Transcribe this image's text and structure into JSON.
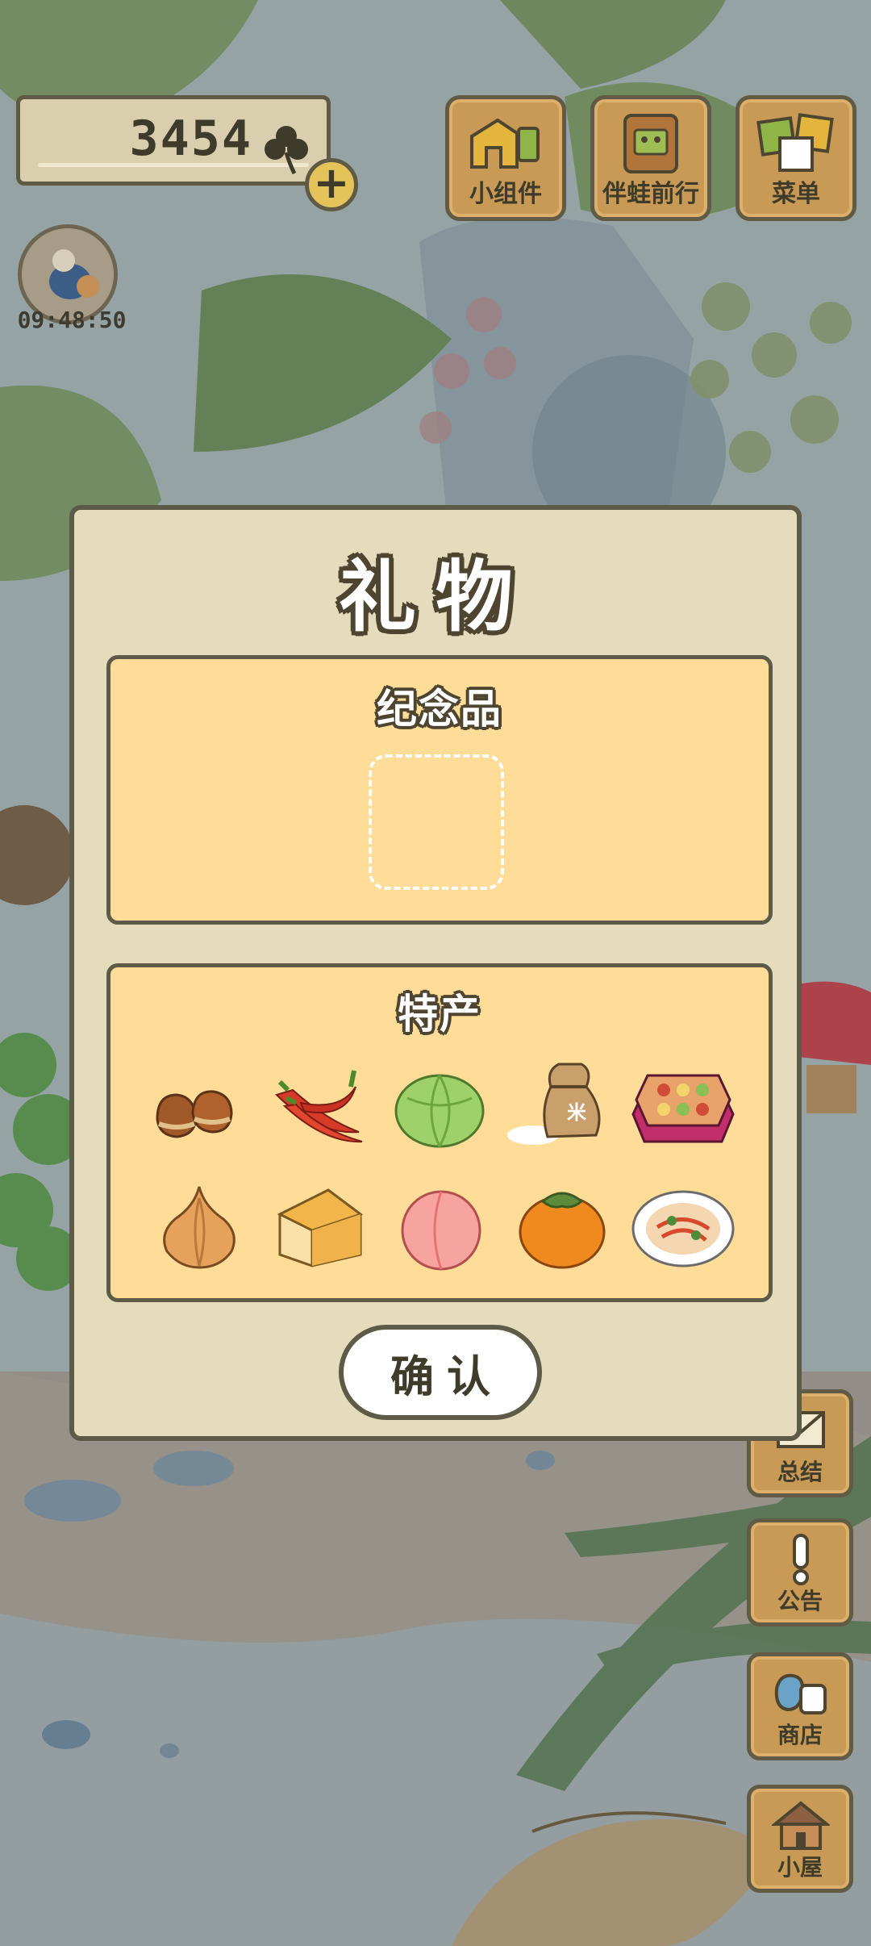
{
  "hud": {
    "clover_count": "3454",
    "add_symbol": "+",
    "timer": "09:48:50",
    "top_buttons": [
      {
        "label": "小组件",
        "icon": "widget-icon"
      },
      {
        "label": "伴蛙前行",
        "icon": "frog-companion-icon"
      },
      {
        "label": "菜单",
        "icon": "menu-icon"
      }
    ],
    "side_buttons": [
      {
        "label": "总结",
        "icon": "letter-icon"
      },
      {
        "label": "公告",
        "icon": "exclamation-icon"
      },
      {
        "label": "商店",
        "icon": "shop-bag-icon"
      },
      {
        "label": "小屋",
        "icon": "house-icon"
      }
    ]
  },
  "dialog": {
    "title": "礼物",
    "souvenir_title": "纪念品",
    "specialty_title": "特产",
    "specialty_items": [
      {
        "name": "chestnut-icon"
      },
      {
        "name": "chili-pepper-icon"
      },
      {
        "name": "cabbage-icon"
      },
      {
        "name": "rice-bag-icon"
      },
      {
        "name": "bento-box-icon"
      },
      {
        "name": "onion-icon"
      },
      {
        "name": "cheese-icon"
      },
      {
        "name": "peach-icon"
      },
      {
        "name": "persimmon-icon"
      },
      {
        "name": "noodle-plate-icon"
      }
    ],
    "confirm_label": "确认"
  },
  "colors": {
    "dialog_bg": "#e5dcbd",
    "panel_bg": "#ffdd99",
    "border": "#5d5b48",
    "wood": "#c89a55"
  }
}
